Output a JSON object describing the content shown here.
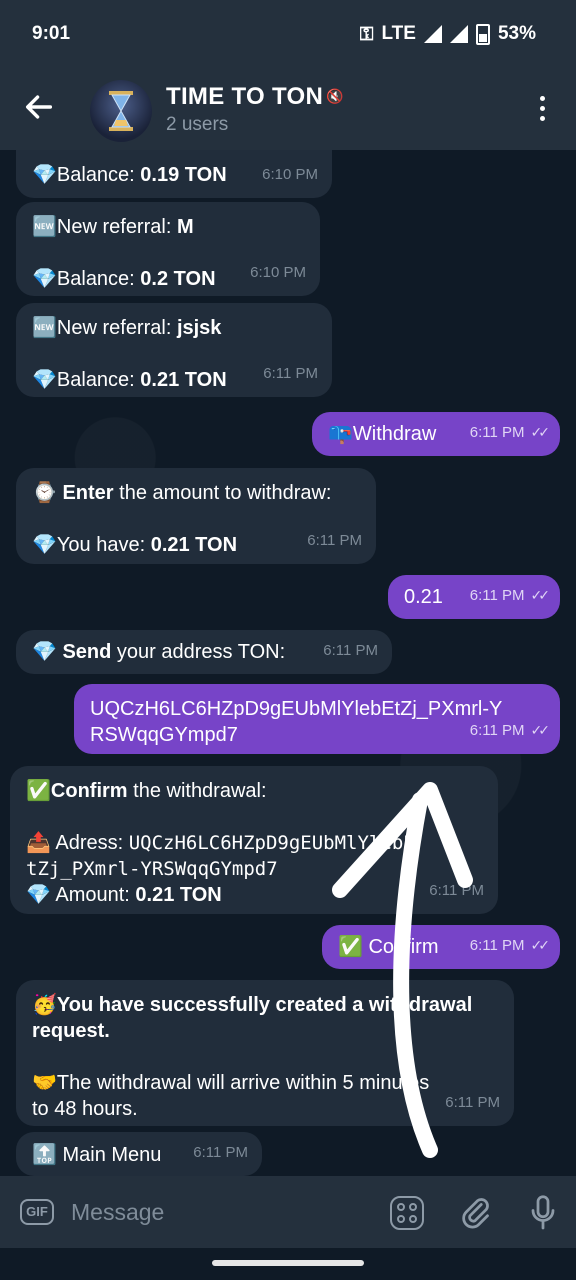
{
  "status": {
    "time": "9:01",
    "network": "LTE",
    "battery": "53%"
  },
  "header": {
    "title": "TIME TO TON",
    "subtitle": "2 users"
  },
  "messages": {
    "m1": {
      "icon": "💎",
      "label": "Balance: ",
      "value": "0.19 TON",
      "time": "6:10 PM"
    },
    "m2": {
      "icon1": "🆕",
      "label1": "New referral: ",
      "value1": "M",
      "icon2": "💎",
      "label2": "Balance: ",
      "value2": "0.2 TON",
      "time": "6:10 PM"
    },
    "m3": {
      "icon1": "🆕",
      "label1": "New referral: ",
      "value1": "jsjsk",
      "icon2": "💎",
      "label2": "Balance: ",
      "value2": "0.21 TON",
      "time": "6:11 PM"
    },
    "m4": {
      "icon": "📪",
      "text": "Withdraw",
      "time": "6:11 PM"
    },
    "m5": {
      "icon1": "⌚",
      "bold1": "Enter",
      "rest1": " the amount to withdraw:",
      "icon2": "💎",
      "label2": "You have: ",
      "value2": "0.21 TON",
      "time": "6:11 PM"
    },
    "m6": {
      "text": "0.21",
      "time": "6:11 PM"
    },
    "m7": {
      "icon": "💎",
      "bold": "Send",
      "rest": " your address TON:",
      "time": "6:11 PM"
    },
    "m8": {
      "line1": "UQCzH6LC6HZpD9gEUbMlYlebEtZj_PXmrl-Y",
      "line2": "RSWqqGYmpd7",
      "time": "6:11 PM"
    },
    "m9": {
      "icon1": "✅",
      "bold1": "Confirm",
      "rest1": " the withdrawal:",
      "icon2": "📤",
      "label2": " Adress:  ",
      "addr1": "UQCzH6LC6HZpD9gEUbMlYlebE",
      "addr2": "tZj_PXmrl-YRSWqqGYmpd7",
      "icon3": "💎",
      "label3": " Amount: ",
      "value3": "0.21 TON",
      "time": "6:11 PM"
    },
    "m10": {
      "icon": "✅",
      "text": " Confirm",
      "time": "6:11 PM"
    },
    "m11": {
      "icon1": "🥳",
      "bold1a": "You have successfully created a withdrawal",
      "bold1b": "request.",
      "icon2": "🤝",
      "text2a": "The withdrawal will arrive within 5 minutes",
      "text2b": "to 48 hours.",
      "time": "6:11 PM"
    },
    "m12": {
      "icon": "🔝",
      "text": " Main Menu",
      "time": "6:11 PM"
    }
  },
  "input": {
    "placeholder": "Message"
  },
  "icons": [
    "back-arrow-icon",
    "mute-icon",
    "more-vert-icon",
    "gif-icon",
    "sticker-icon",
    "attach-icon",
    "mic-icon",
    "key-icon",
    "signal-icon",
    "battery-icon"
  ],
  "colors": {
    "header": "#24303d",
    "incoming": "#212d3b",
    "outgoing": "#7744c8",
    "background": "#0f1a26"
  }
}
